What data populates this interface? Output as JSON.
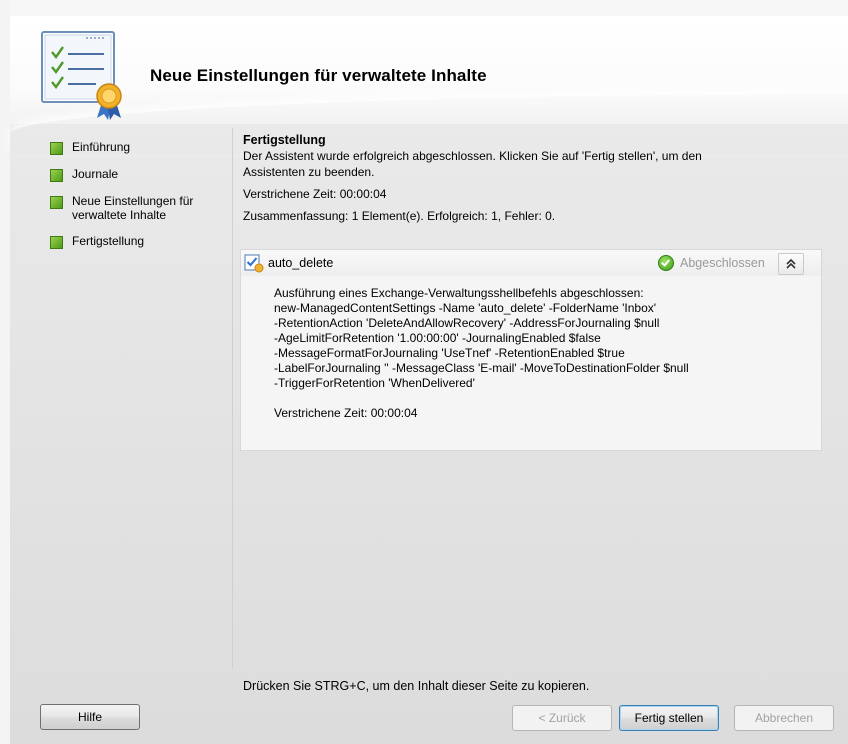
{
  "wizard": {
    "title": "Neue Einstellungen für verwaltete Inhalte",
    "icon": "checklist-certificate-icon"
  },
  "steps": [
    {
      "label": "Einführung",
      "status_color": "#5cb82a"
    },
    {
      "label": "Journale",
      "status_color": "#5cb82a"
    },
    {
      "label": "Neue Einstellungen für verwaltete Inhalte",
      "status_color": "#5cb82a"
    },
    {
      "label": "Fertigstellung",
      "status_color": "#5cb82a"
    }
  ],
  "completion": {
    "heading": "Fertigstellung",
    "message_line1": "Der Assistent wurde erfolgreich abgeschlossen. Klicken Sie auf 'Fertig stellen', um den",
    "message_line2": "Assistenten zu beenden.",
    "elapsed": "Verstrichene Zeit: 00:00:04",
    "summary": "Zusammenfassung: 1 Element(e). Erfolgreich: 1, Fehler: 0."
  },
  "task": {
    "name": "auto_delete",
    "status": "Abgeschlossen",
    "status_icon": "green-check-icon",
    "collapse_glyph": "≈",
    "output_lines": [
      "Ausführung eines Exchange-Verwaltungsshellbefehls abgeschlossen:",
      "new-ManagedContentSettings -Name 'auto_delete' -FolderName 'Inbox'",
      "-RetentionAction 'DeleteAndAllowRecovery' -AddressForJournaling $null",
      "-AgeLimitForRetention '1.00:00:00' -JournalingEnabled $false",
      "-MessageFormatForJournaling 'UseTnef' -RetentionEnabled $true",
      "-LabelForJournaling '' -MessageClass 'E-mail' -MoveToDestinationFolder $null",
      "-TriggerForRetention 'WhenDelivered'"
    ],
    "elapsed": "Verstrichene Zeit: 00:00:04"
  },
  "hint": "Drücken Sie STRG+C, um den Inhalt dieser Seite zu kopieren.",
  "buttons": {
    "help": "Hilfe",
    "back": "< Zurück",
    "finish": "Fertig stellen",
    "cancel": "Abbrechen"
  }
}
